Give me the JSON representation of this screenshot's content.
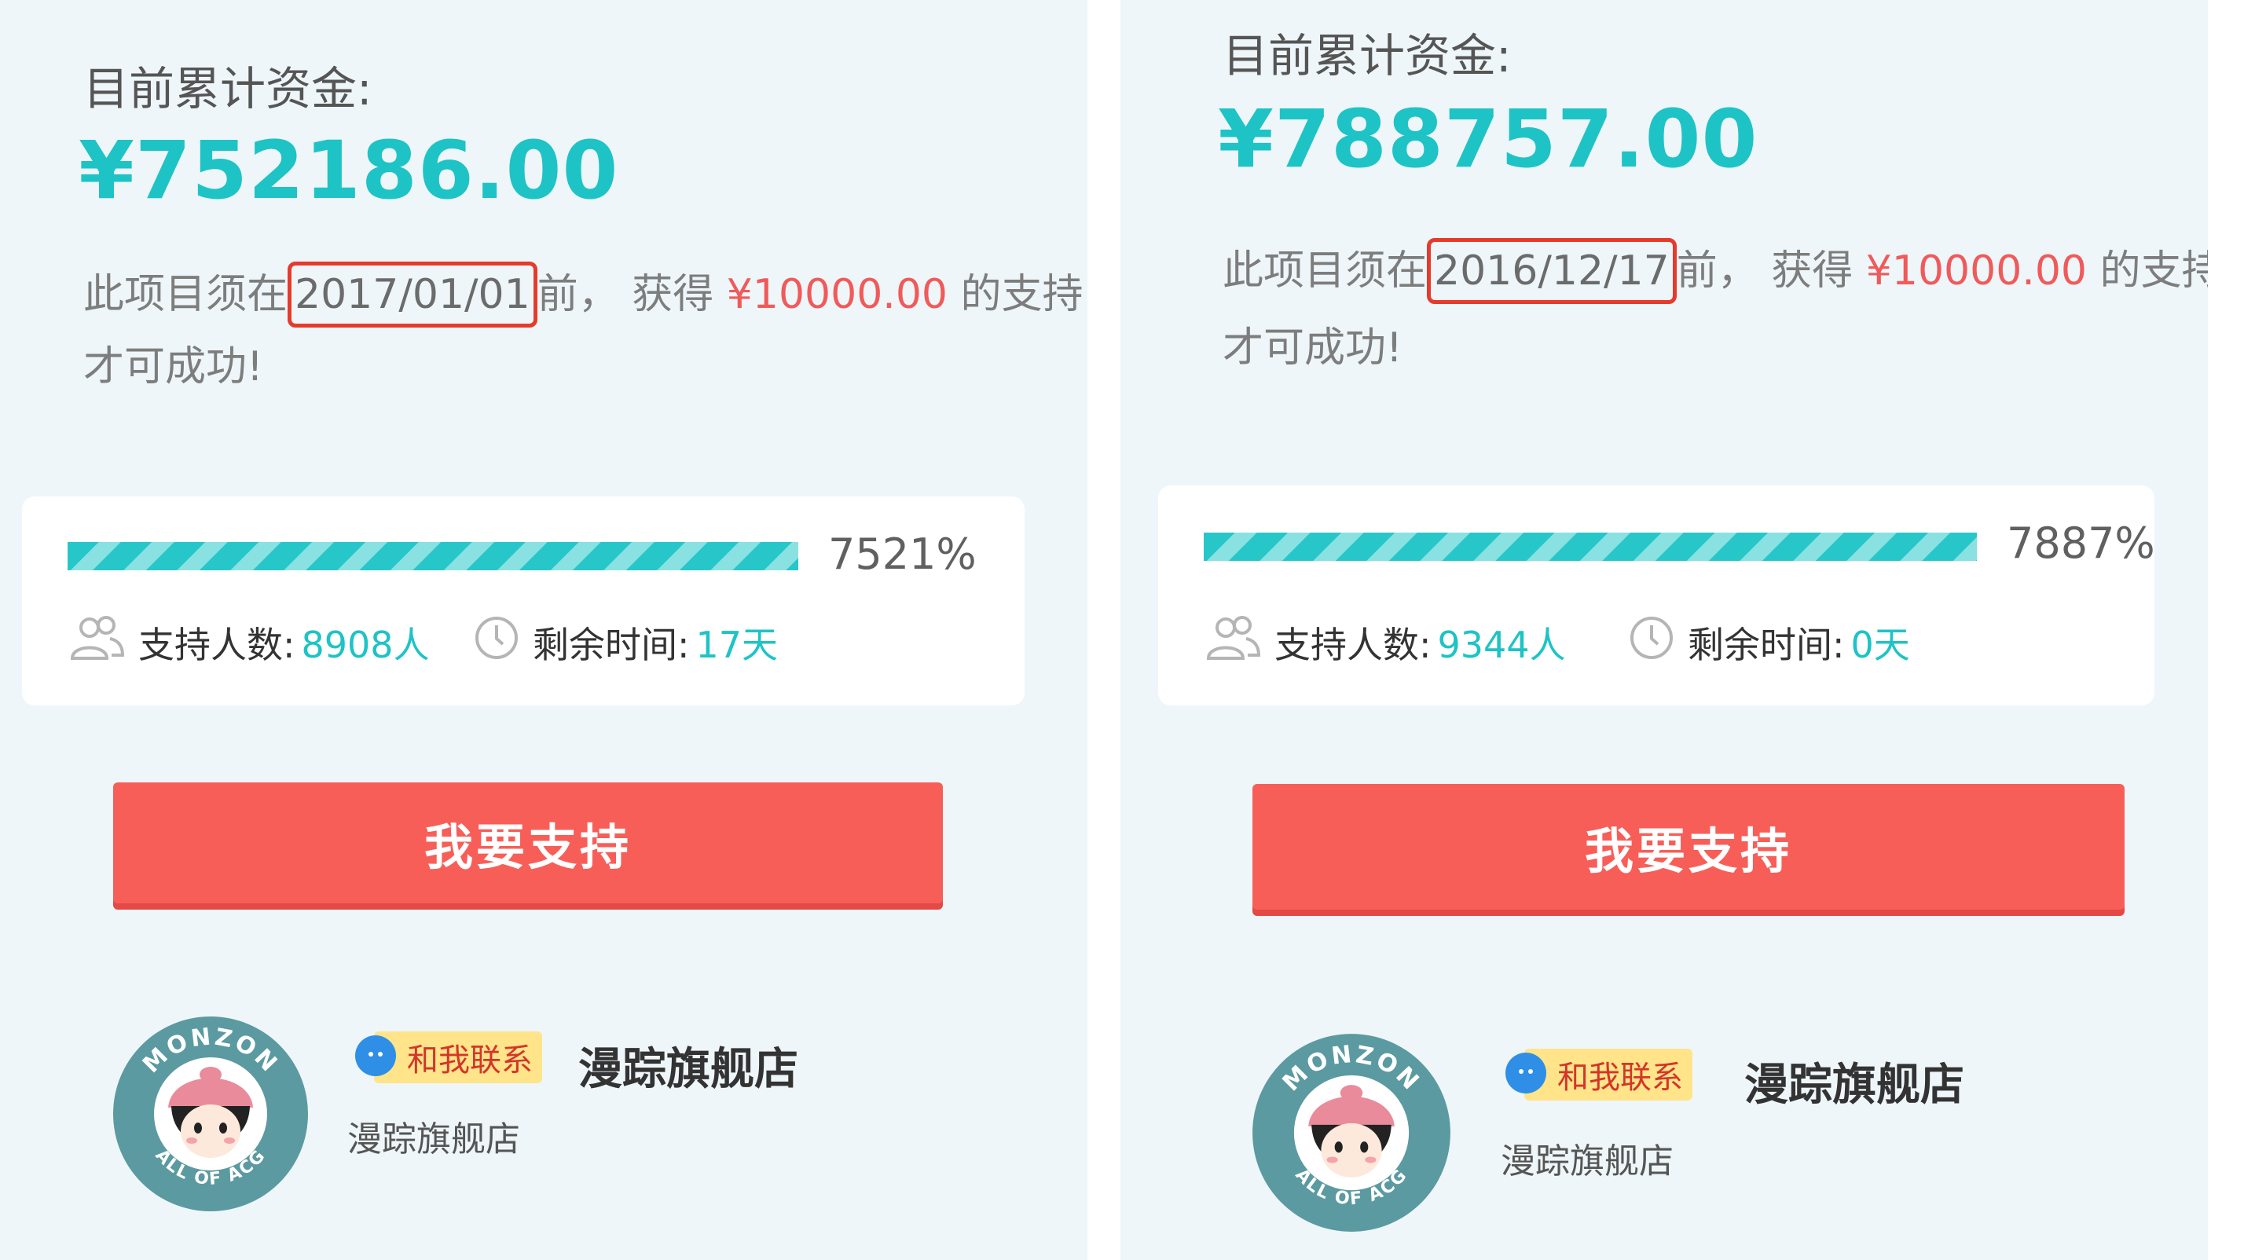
{
  "panels": [
    {
      "funds_label": "目前累计资金:",
      "amount": "¥752186.00",
      "deadline_prefix": "此项目须在",
      "deadline_date": "2017/01/01",
      "deadline_mid": "前， 获得",
      "target_amount": "¥10000.00",
      "deadline_suffix": "的支持",
      "deadline_line2": "才可成功!",
      "progress_percent_text": "7521%",
      "progress_fraction": 1.0,
      "supporters_label": "支持人数:",
      "supporters_value": "8908人",
      "remaining_label": "剩余时间:",
      "remaining_value": "17天",
      "support_button": "我要支持",
      "contact_label": "和我联系",
      "store_name": "漫踪旗舰店",
      "store_subtitle": "漫踪旗舰店",
      "logo_text_top": "MONZON",
      "logo_text_bottom": "ALL OF ACG"
    },
    {
      "funds_label": "目前累计资金:",
      "amount": "¥788757.00",
      "deadline_prefix": "此项目须在",
      "deadline_date": "2016/12/17",
      "deadline_mid": "前， 获得",
      "target_amount": "¥10000.00",
      "deadline_suffix": "的支持",
      "deadline_line2": "才可成功!",
      "progress_percent_text": "7887%",
      "progress_fraction": 1.0,
      "supporters_label": "支持人数:",
      "supporters_value": "9344人",
      "remaining_label": "剩余时间:",
      "remaining_value": "0天",
      "support_button": "我要支持",
      "contact_label": "和我联系",
      "store_name": "漫踪旗舰店",
      "store_subtitle": "漫踪旗舰店",
      "logo_text_top": "MONZON",
      "logo_text_bottom": "ALL OF ACG"
    }
  ],
  "colors": {
    "accent": "#1ec3c6",
    "highlight_red": "#f05a5a",
    "date_outline": "#e53b2c",
    "button": "#f85e58",
    "panel_bg": "#eef6f9"
  },
  "icons": {
    "supporters": "people-icon",
    "remaining": "clock-icon",
    "contact": "chat-bubble-icon"
  }
}
